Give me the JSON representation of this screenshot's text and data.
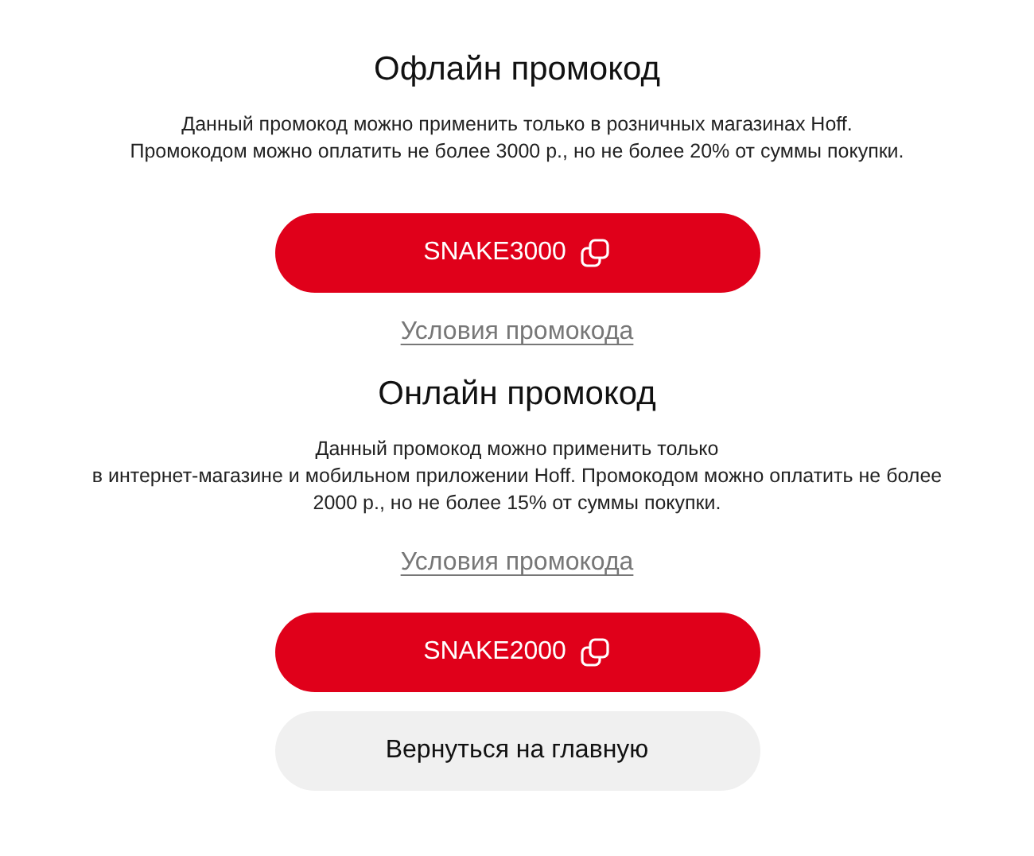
{
  "sections": [
    {
      "title": "Офлайн промокод",
      "description_lines": [
        "Данный промокод можно применить только в розничных магазинах Hoff.",
        "Промокодом можно оплатить не более 3000 р., но не более 20% от суммы покупки."
      ],
      "parts": [
        {
          "kind": "code",
          "text": "SNAKE3000"
        },
        {
          "kind": "link",
          "text": "Условия промокода"
        }
      ]
    },
    {
      "title": "Онлайн промокод",
      "description_lines": [
        "Данный промокод можно применить только",
        "в интернет-магазине и мобильном приложении Hoff. Промокодом можно оплатить не более",
        "2000 р., но не более 15% от суммы покупки."
      ],
      "parts": [
        {
          "kind": "link",
          "text": "Условия промокода"
        },
        {
          "kind": "code",
          "text": "SNAKE2000"
        }
      ]
    }
  ],
  "back_button": "Вернуться на главную"
}
